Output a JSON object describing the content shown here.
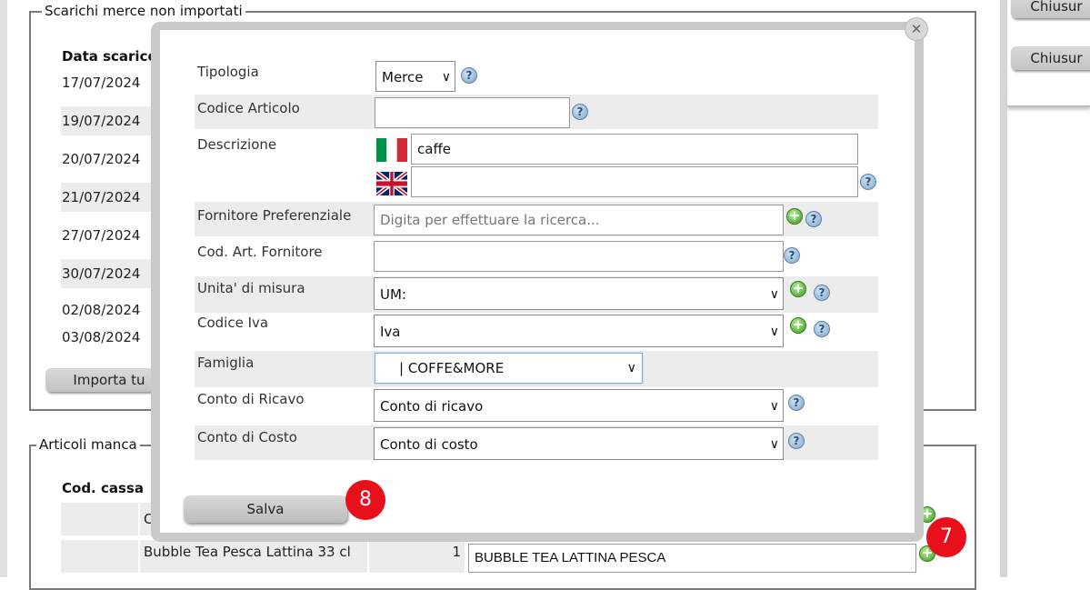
{
  "background": {
    "section1": {
      "legend": "Scarichi merce non importati",
      "column_header": "Data scarico",
      "dates": [
        "17/07/2024",
        "19/07/2024",
        "20/07/2024",
        "21/07/2024",
        "27/07/2024",
        "30/07/2024",
        "02/08/2024",
        "03/08/2024"
      ],
      "import_button": "Importa tu"
    },
    "section2": {
      "legend": "Articoli manca",
      "column_header": "Cod. cassa",
      "row1_partial": "C",
      "row2_name": "Bubble Tea Pesca Lattina 33 cl",
      "row2_qty": "1",
      "row2_input": "BUBBLE TEA LATTINA PESCA"
    },
    "right_buttons": [
      "Chiusur",
      "Chiusur"
    ]
  },
  "modal": {
    "close_symbol": "✕",
    "fields": {
      "tipologia": {
        "label": "Tipologia",
        "value": "Merce"
      },
      "codice_articolo": {
        "label": "Codice Articolo",
        "value": ""
      },
      "descrizione": {
        "label": "Descrizione",
        "value_it": "caffe",
        "value_en": ""
      },
      "fornitore": {
        "label": "Fornitore Preferenziale",
        "placeholder": "Digita per effettuare la ricerca..."
      },
      "cod_art_fornitore": {
        "label": "Cod. Art. Fornitore",
        "value": ""
      },
      "unita_misura": {
        "label": "Unita' di misura",
        "value": "UM:"
      },
      "codice_iva": {
        "label": "Codice Iva",
        "value": "Iva"
      },
      "famiglia": {
        "label": "Famiglia",
        "value": "| COFFE&MORE"
      },
      "conto_ricavo": {
        "label": "Conto di Ricavo",
        "value": "Conto di ricavo"
      },
      "conto_costo": {
        "label": "Conto di Costo",
        "value": "Conto di costo"
      }
    },
    "save_label": "Salva",
    "help_symbol": "?",
    "add_symbol": "+"
  },
  "badges": {
    "step8": "8",
    "step7": "7"
  },
  "colors": {
    "badge": "#e8101a",
    "help_icon": "#7fa6cc",
    "add_icon": "#3c9a1f"
  }
}
